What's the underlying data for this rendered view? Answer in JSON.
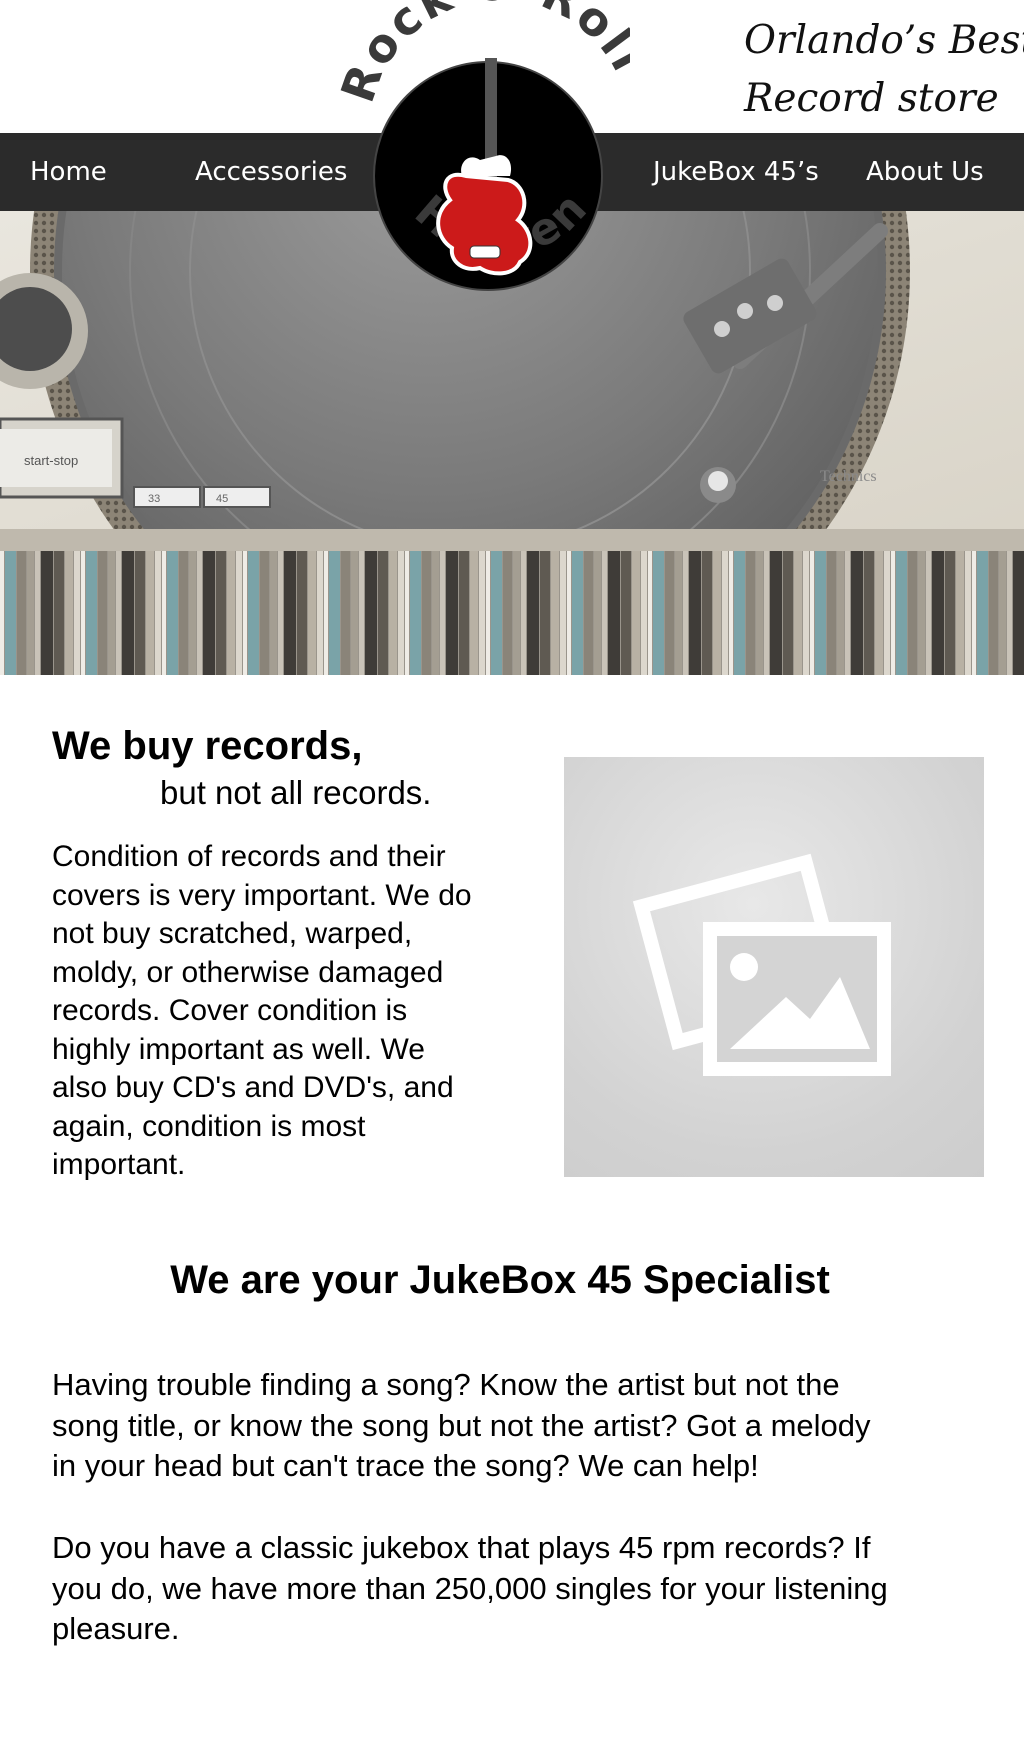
{
  "header": {
    "tagline_line1": "Orlando’s Best",
    "tagline_line2": "Record store",
    "logo": {
      "top_text": "Rock & Roll",
      "bottom_text": "Heaven"
    }
  },
  "nav": {
    "home": "Home",
    "accessories": "Accessories",
    "jukebox": "JukeBox 45’s",
    "about": "About Us"
  },
  "hero": {
    "turntable_labels": {
      "start_stop": "start-stop",
      "speed_33": "33",
      "speed_45": "45",
      "brand": "Technics"
    }
  },
  "buy_section": {
    "heading": "We buy records,",
    "subheading": "but not all records.",
    "body_lines": [
      "Condition of records and their",
      "covers is very important.  We do",
      "not buy scratched, warped,",
      "moldy, or otherwise damaged",
      "records.  Cover condition is",
      "highly important as well.  We",
      "also buy CD's and DVD's, and",
      "again, condition is most",
      "important."
    ]
  },
  "jukebox_section": {
    "heading": "We are your JukeBox 45 Specialist",
    "para1_lines": [
      "Having trouble finding a song? Know the artist but not the",
      "song title, or know the song but not the artist? Got a melody",
      "in your head but can't trace the song? We can help!"
    ],
    "para2_lines": [
      "Do you have a classic jukebox that plays 45 rpm records? If",
      "you do, we have more than 250,000 singles for your listening",
      "pleasure."
    ]
  },
  "colors": {
    "nav_bg": "#2b2b2b",
    "logo_disc": "#000000",
    "guitar_red": "#cc1a1a",
    "logo_text": "#3a3a3a",
    "placeholder_bg": "#d4d4d4"
  }
}
